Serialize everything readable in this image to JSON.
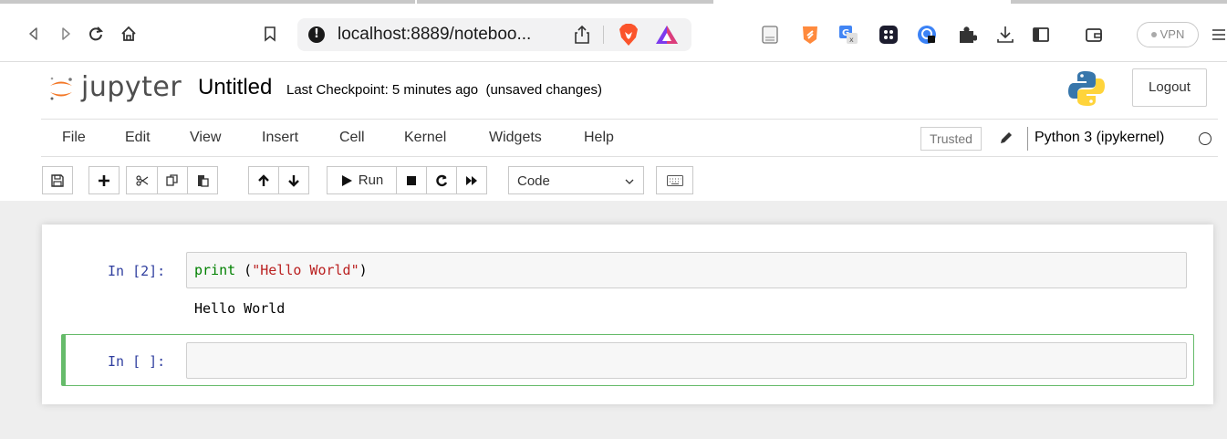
{
  "browser": {
    "url": "localhost:8889/noteboo...",
    "vpn_label": "VPN"
  },
  "header": {
    "logo_text": "jupyter",
    "title": "Untitled",
    "checkpoint": "Last Checkpoint: 5 minutes ago",
    "unsaved": "(unsaved changes)",
    "logout": "Logout"
  },
  "menubar": {
    "items": [
      "File",
      "Edit",
      "View",
      "Insert",
      "Cell",
      "Kernel",
      "Widgets",
      "Help"
    ],
    "trusted": "Trusted",
    "kernel": "Python 3 (ipykernel)"
  },
  "toolbar": {
    "run_label": "Run",
    "cell_type": "Code"
  },
  "cells": [
    {
      "prompt": "In [2]:",
      "code_keyword": "print",
      "code_space": " (",
      "code_string": "\"Hello World\"",
      "code_close": ")",
      "output": "Hello World"
    },
    {
      "prompt": "In [ ]:",
      "code": ""
    }
  ],
  "colors": {
    "prompt": "#303f9f",
    "keyword": "#008000",
    "string": "#ba2121",
    "selected_border": "#66bb6a"
  },
  "icons": [
    "back-icon",
    "forward-icon",
    "reload-icon",
    "home-icon",
    "bookmark-icon",
    "info-icon",
    "share-icon",
    "brave-lion-icon",
    "brave-rewards-icon",
    "reader-icon",
    "extension-icons",
    "download-icon",
    "sidebar-icon",
    "wallet-icon",
    "menu-icon",
    "save-icon",
    "plus-icon",
    "cut-icon",
    "copy-icon",
    "paste-icon",
    "arrow-up-icon",
    "arrow-down-icon",
    "play-icon",
    "stop-icon",
    "restart-icon",
    "fast-forward-icon",
    "keyboard-icon",
    "pencil-icon",
    "kernel-idle-icon"
  ]
}
